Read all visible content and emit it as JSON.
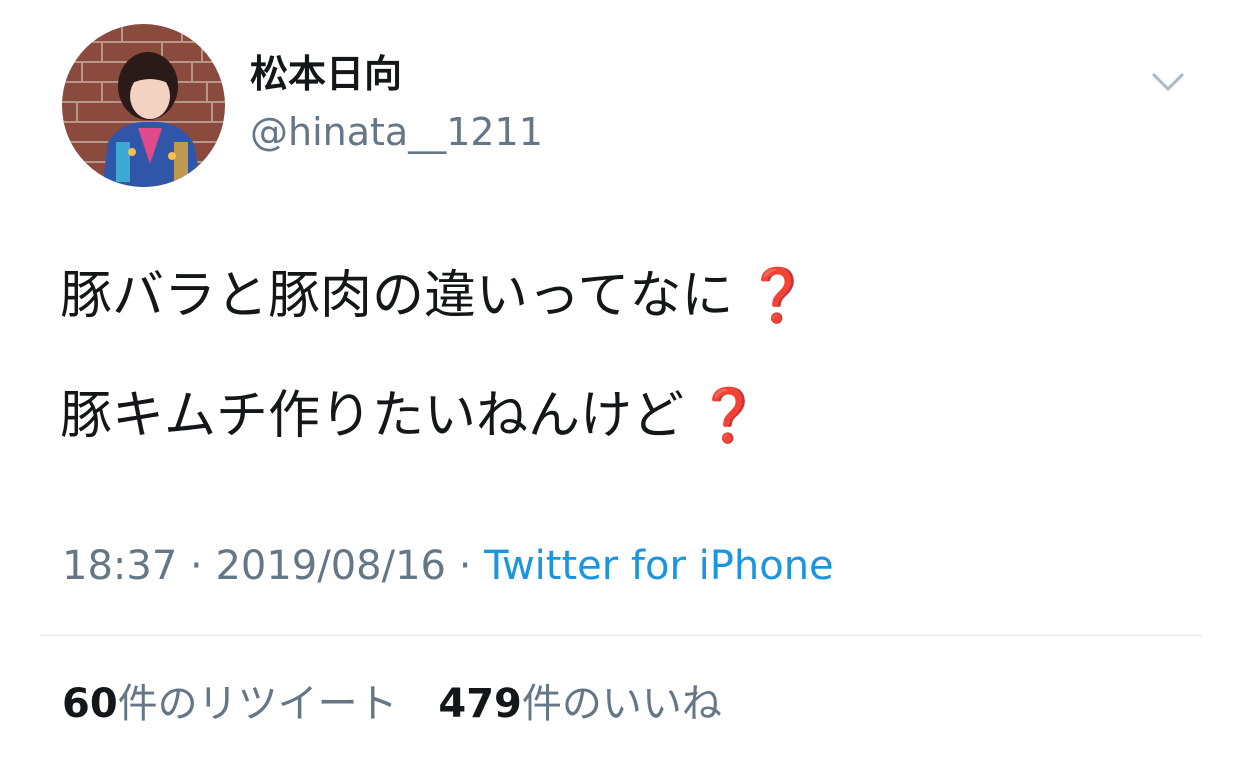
{
  "user": {
    "display_name": "松本日向",
    "handle": "@hinata__1211",
    "avatar_icon": "profile-photo"
  },
  "menu": {
    "icon": "chevron-down-icon"
  },
  "tweet": {
    "lines": [
      {
        "text": "豚バラと豚肉の違いってなに",
        "icon": "❓"
      },
      {
        "text": "豚キムチ作りたいねんけど",
        "icon": "❓"
      }
    ]
  },
  "meta": {
    "time": "18:37",
    "separator": " · ",
    "date": "2019/08/16",
    "source": "Twitter for iPhone"
  },
  "stats": {
    "retweets": {
      "count": "60",
      "label": "件のリツイート"
    },
    "likes": {
      "count": "479",
      "label": "件のいいね"
    }
  },
  "colors": {
    "text_primary": "#14171a",
    "text_secondary": "#657786",
    "link": "#1b95e0",
    "divider": "#e1e8ed",
    "emoji_red": "#d0021b"
  }
}
